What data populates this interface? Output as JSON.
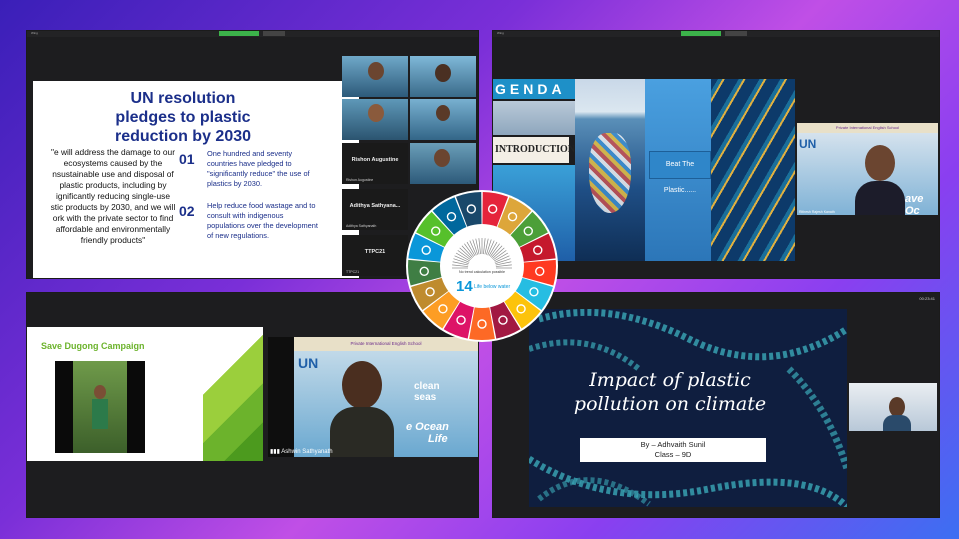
{
  "panel_tl": {
    "topbar_label": "Wing",
    "slide": {
      "title_lines": [
        "UN resolution",
        "pledges to plastic",
        "reduction by 2030"
      ],
      "quote_lines": [
        "\"e will address the damage to our",
        "ecosystems caused by the",
        "nsustainable use and disposal of",
        "plastic products, including by",
        "ignificantly reducing single-use",
        "stic products by 2030, and we will",
        "ork with the private sector to find",
        "affordable and environmentally",
        "friendly products\""
      ],
      "points": [
        {
          "num": "01",
          "lines": [
            "One hundred and seventy",
            "countries have pledged to",
            "\"significantly reduce\" the use of",
            "plastics by 2030."
          ]
        },
        {
          "num": "02",
          "lines": [
            "Help reduce food wastage and to",
            "consult with indigenous",
            "populations over the development",
            "of new regulations."
          ]
        }
      ]
    },
    "participants": [
      {
        "name": "Rishon Augustine",
        "tile_label": "Rishon Augustine"
      },
      {
        "name": "Adithya Sathyana...",
        "tile_label": "Adithya Sathyanath"
      },
      {
        "name": "TTPC21",
        "tile_label": "TTPC21"
      }
    ]
  },
  "panel_tr": {
    "topbar_label": "Wing",
    "agenda_text": "GENDA",
    "intro_text": "INTRODUCTION",
    "beat_text": "Beat The Plastic......",
    "speaker_label": "Rithesh Rajesh Kanath",
    "school_banner": "Private International English School",
    "un_text": "UN",
    "ocean_text": "ave Oc"
  },
  "panel_bl": {
    "slide_title": "Save Dugong Campaign",
    "video_label": "Ashwin Sathyanath",
    "un_text": "UN",
    "clean_seas": "clean seas",
    "ocean_line1": "e Ocean",
    "ocean_line2": "Life",
    "school_banner": "Private International English School"
  },
  "panel_br": {
    "timer": "00:23:41",
    "title_lines": [
      "Impact of plastic",
      "pollution on climate"
    ],
    "by_line": "By – Adhvaith Sunil",
    "class_line": "Class – 9D"
  },
  "sdg_wheel": {
    "center_caption": "No trend calculation possible",
    "goal_number": "14",
    "goal_label": "Life below water",
    "colors": [
      "#e5243b",
      "#dda63a",
      "#4c9f38",
      "#c5192d",
      "#ff3a21",
      "#26bde2",
      "#fcc30b",
      "#a21942",
      "#fd6925",
      "#dd1367",
      "#fd9d24",
      "#bf8b2e",
      "#3f7e44",
      "#0a97d9",
      "#56c02b",
      "#00689d",
      "#19486a"
    ]
  }
}
